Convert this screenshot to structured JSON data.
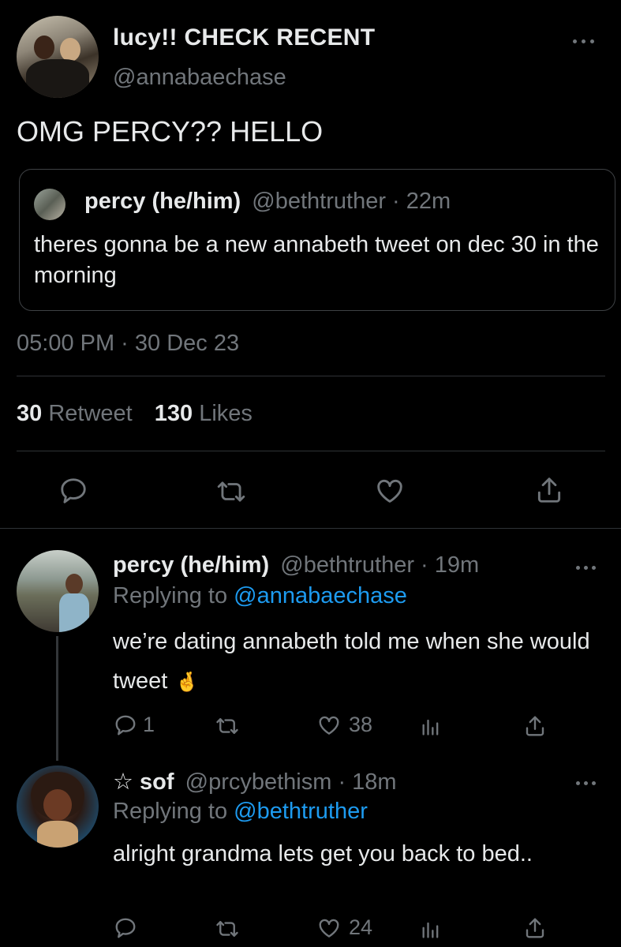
{
  "colors": {
    "background": "#000000",
    "text": "#e7e9ea",
    "secondary": "#71767b",
    "link": "#1d9bf0",
    "border": "#2f3336"
  },
  "main_tweet": {
    "display_name": "lucy!! CHECK RECENT",
    "handle": "@annabaechase",
    "text": "OMG PERCY?? HELLO",
    "timestamp": "05:00 PM · 30 Dec 23",
    "more_icon": "more-dots-icon"
  },
  "quoted_tweet": {
    "display_name": "percy (he/him)",
    "meta": "@bethtruther · 22m",
    "text": "theres gonna be a new annabeth tweet on dec 30 in the morning"
  },
  "stats": {
    "retweets_count": "30",
    "retweets_label": "Retweet",
    "likes_count": "130",
    "likes_label": "Likes"
  },
  "main_actions": [
    "reply-icon",
    "retweet-icon",
    "heart-icon",
    "share-icon"
  ],
  "replies": [
    {
      "display_name": "percy (he/him)",
      "meta": "@bethtruther · 19m",
      "replying_prefix": "Replying to",
      "replying_to": "@annabaechase",
      "text": "we’re dating annabeth told me when she would tweet",
      "emoji": "🤞",
      "reply_count": "1",
      "like_count": "38"
    },
    {
      "display_name": "☆ sof",
      "meta": "@prcybethism · 18m",
      "replying_prefix": "Replying to",
      "replying_to": "@bethtruther",
      "text": "alright grandma lets get you back to bed..",
      "like_count": "24"
    }
  ]
}
